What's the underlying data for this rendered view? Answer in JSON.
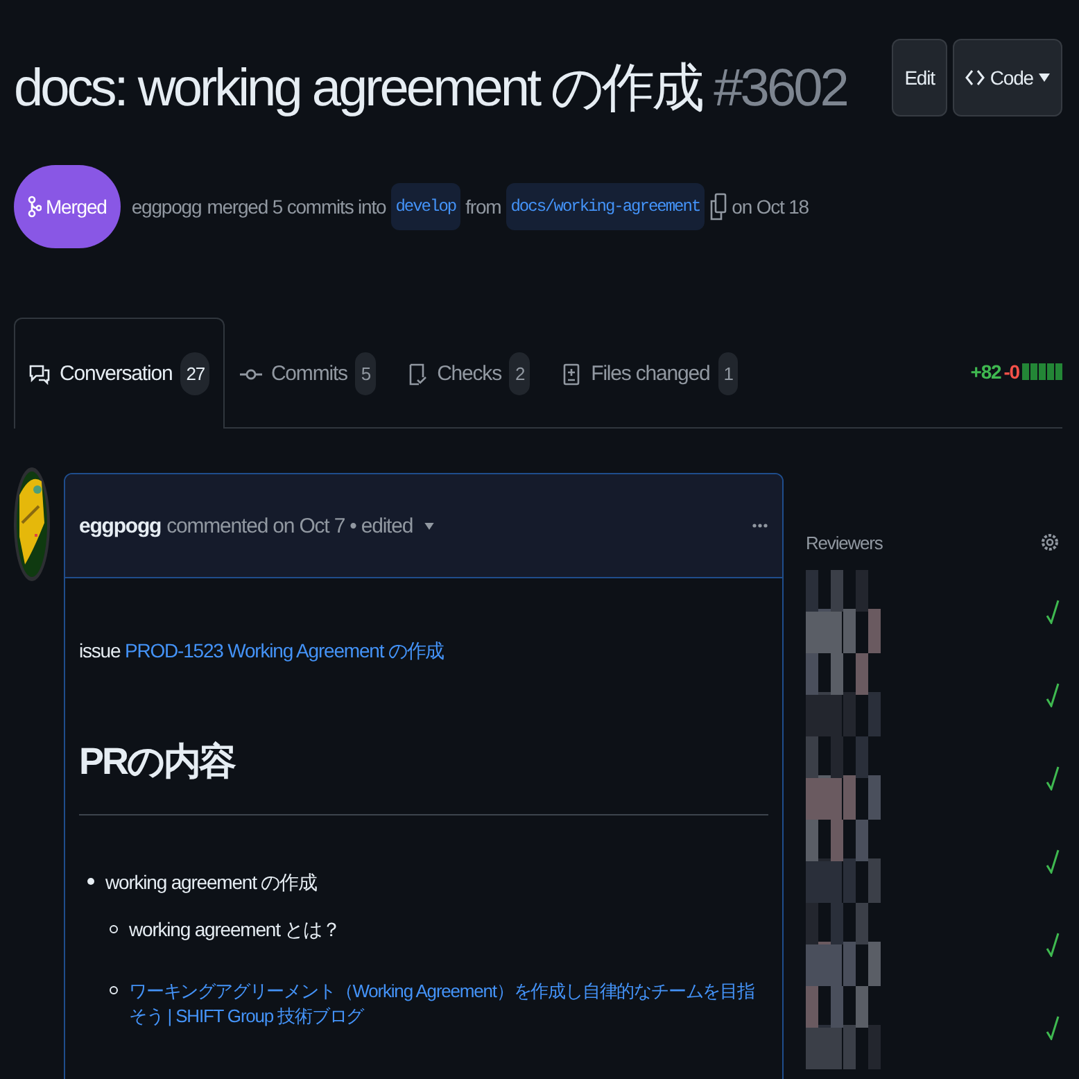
{
  "title": "docs: working agreement の作成",
  "number": "#3602",
  "header_buttons": [
    {
      "kind": "edit",
      "label": "Edit"
    },
    {
      "kind": "code",
      "label": "Code"
    }
  ],
  "state": {
    "label": "Merged"
  },
  "summary": {
    "author": "eggpogg",
    "action": "merged 5 commits into",
    "base": "develop",
    "from": "from",
    "head": "docs/working-agreement",
    "date": "on Oct 18"
  },
  "tabs": [
    {
      "kind": "conversation",
      "label": "Conversation",
      "count": "27",
      "selected": true
    },
    {
      "kind": "commits",
      "label": "Commits",
      "count": "5",
      "selected": false
    },
    {
      "kind": "checks",
      "label": "Checks",
      "count": "2",
      "selected": false
    },
    {
      "kind": "files",
      "label": "Files changed",
      "count": "1",
      "selected": false
    }
  ],
  "diffstat": {
    "additions": "+82",
    "deletions": "-0"
  },
  "comment": {
    "author": "eggpogg",
    "meta": "commented on Oct 7 • edited",
    "issue_prefix": "issue",
    "issue_link": "PROD-1523 Working Agreement の作成",
    "heading": "PRの内容",
    "items": [
      {
        "text": "working agreement の作成",
        "link": false,
        "children": [
          {
            "text": "working agreement とは？",
            "link": false
          },
          {
            "text": "ワーキングアグリーメント（Working Agreement）を作成し自律的なチームを目指そう | SHIFT Group 技術ブログ",
            "link": true
          }
        ]
      }
    ]
  },
  "sidebar": {
    "title": "Reviewers",
    "reviewers": [
      {
        "approved": true
      },
      {
        "approved": true
      },
      {
        "approved": true
      },
      {
        "approved": true
      },
      {
        "approved": true
      },
      {
        "approved": true
      }
    ]
  }
}
